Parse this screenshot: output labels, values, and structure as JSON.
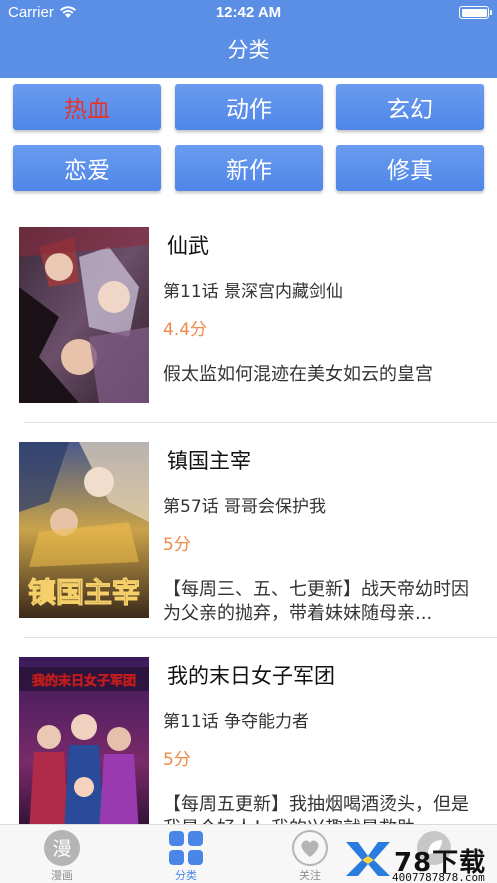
{
  "status_bar": {
    "carrier": "Carrier",
    "time": "12:42 AM"
  },
  "nav": {
    "title": "分类"
  },
  "categories": [
    {
      "label": "热血",
      "active": true
    },
    {
      "label": "动作",
      "active": false
    },
    {
      "label": "玄幻",
      "active": false
    },
    {
      "label": "恋爱",
      "active": false
    },
    {
      "label": "新作",
      "active": false
    },
    {
      "label": "修真",
      "active": false
    }
  ],
  "comics": [
    {
      "title": "仙武",
      "chapter": "第11话 景深宫内藏剑仙",
      "score": "4.4分",
      "desc": "假太监如何混迹在美女如云的皇宫"
    },
    {
      "title": "镇国主宰",
      "chapter": "第57话 哥哥会保护我",
      "score": "5分",
      "desc": "【每周三、五、七更新】战天帝幼时因为父亲的抛弃，带着妹妹随母亲..."
    },
    {
      "title": "我的末日女子军团",
      "chapter": "第11话 争夺能力者",
      "score": "5分",
      "desc": "【每周五更新】我抽烟喝酒烫头，但是我是个好人！我的兴趣就是救助..."
    }
  ],
  "covers": [
    {
      "text": ""
    },
    {
      "text": "镇国主宰"
    },
    {
      "text": "我的末日女子军团"
    }
  ],
  "tabbar": {
    "items": [
      {
        "label": "漫画",
        "icon": "manga-icon",
        "glyph": "漫",
        "active": false
      },
      {
        "label": "分类",
        "icon": "category-grid-icon",
        "active": true
      },
      {
        "label": "关注",
        "icon": "heart-icon",
        "active": false
      },
      {
        "label": "",
        "icon": "leaf-icon",
        "active": false
      }
    ]
  },
  "watermark": {
    "brand": "78下载",
    "url": "4007787878.com"
  },
  "colors": {
    "header": "#5b8fe6",
    "button": "#5b8fe6",
    "active_text": "#e8342a",
    "score": "#f08a4b",
    "tab_active": "#4a86e8"
  }
}
